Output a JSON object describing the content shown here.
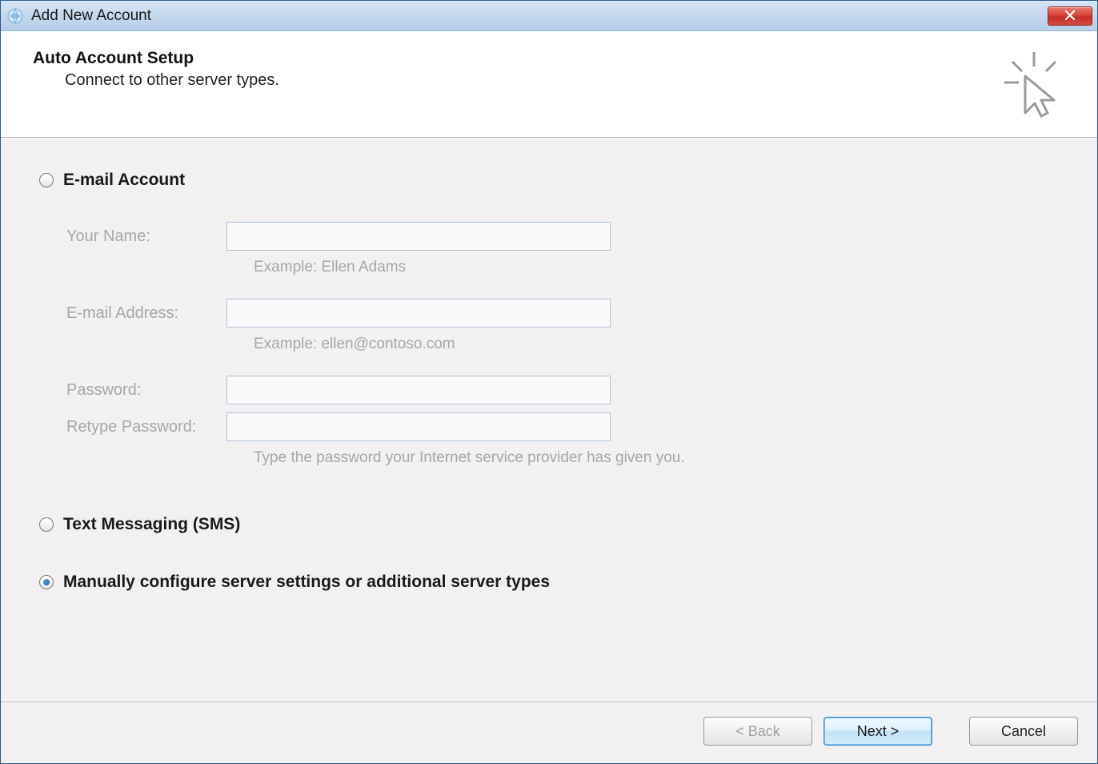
{
  "window": {
    "title": "Add New Account"
  },
  "header": {
    "title": "Auto Account Setup",
    "subtitle": "Connect to other server types."
  },
  "options": {
    "email": {
      "label": "E-mail Account",
      "selected": false,
      "fields": {
        "name_label": "Your Name:",
        "name_value": "",
        "name_hint": "Example: Ellen Adams",
        "email_label": "E-mail Address:",
        "email_value": "",
        "email_hint": "Example: ellen@contoso.com",
        "password_label": "Password:",
        "password_value": "",
        "retype_label": "Retype Password:",
        "retype_value": "",
        "password_hint": "Type the password your Internet service provider has given you."
      }
    },
    "sms": {
      "label": "Text Messaging (SMS)",
      "selected": false
    },
    "manual": {
      "label": "Manually configure server settings or additional server types",
      "selected": true
    }
  },
  "footer": {
    "back": "< Back",
    "next": "Next >",
    "cancel": "Cancel"
  }
}
